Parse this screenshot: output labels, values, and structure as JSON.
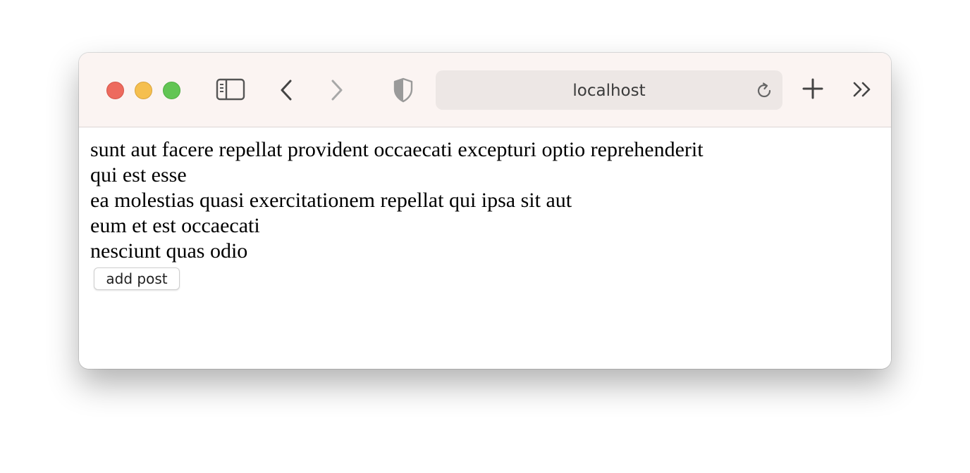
{
  "browser": {
    "address_text": "localhost",
    "traffic_colors": {
      "close": "#ed6a5e",
      "minimize": "#f5bf4f",
      "maximize": "#62c554"
    },
    "toolbar_icons": [
      "sidebar-icon",
      "back-chevron-icon",
      "forward-chevron-icon",
      "privacy-shield-icon",
      "reload-icon",
      "new-tab-plus-icon",
      "more-chevrons-icon"
    ]
  },
  "page": {
    "posts": [
      {
        "title": "sunt aut facere repellat provident occaecati excepturi optio reprehenderit"
      },
      {
        "title": "qui est esse"
      },
      {
        "title": "ea molestias quasi exercitationem repellat qui ipsa sit aut"
      },
      {
        "title": "eum et est occaecati"
      },
      {
        "title": "nesciunt quas odio"
      }
    ],
    "add_button_label": "add post"
  }
}
